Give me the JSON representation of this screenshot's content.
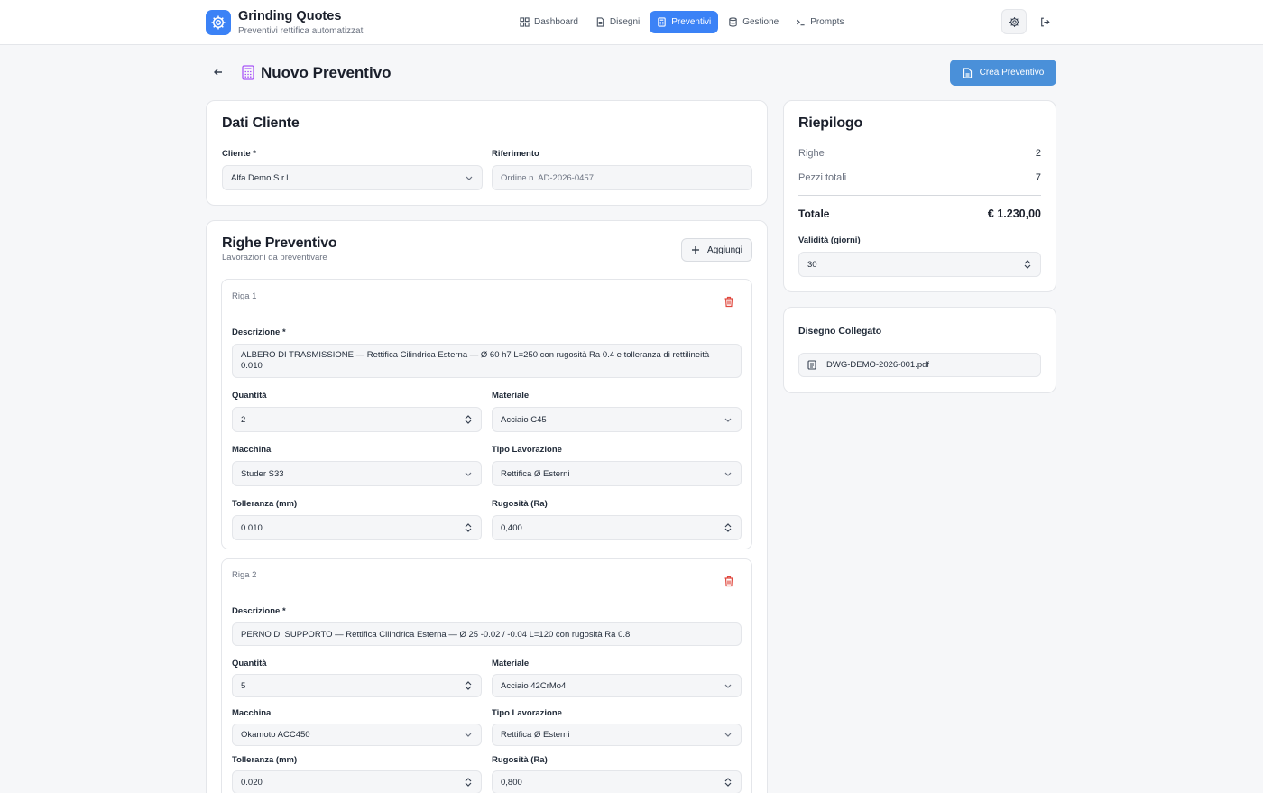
{
  "app": {
    "title": "Grinding Quotes",
    "subtitle": "Preventivi rettifica automatizzati"
  },
  "nav": [
    {
      "label": "Dashboard",
      "icon": "grid-icon",
      "active": false
    },
    {
      "label": "Disegni",
      "icon": "file-icon",
      "active": false
    },
    {
      "label": "Preventivi",
      "icon": "calculator-icon",
      "active": true
    },
    {
      "label": "Gestione",
      "icon": "database-icon",
      "active": false
    },
    {
      "label": "Prompts",
      "icon": "terminal-icon",
      "active": false
    }
  ],
  "colors": {
    "accent": "#3b82f6",
    "primary_button": "#4a90d9",
    "danger": "#e0483e",
    "page_icon": "#a855f7"
  },
  "page": {
    "title": "Nuovo Preventivo",
    "create_label": "Crea Preventivo"
  },
  "cliente": {
    "title": "Dati Cliente",
    "cliente_label": "Cliente *",
    "cliente_value": "Alfa Demo S.r.l.",
    "riferimento_label": "Riferimento",
    "riferimento_placeholder": "Ordine n. AD-2026-0457"
  },
  "righe": {
    "title": "Righe Preventivo",
    "subtitle": "Lavorazioni da preventivare",
    "add_label": "Aggiungi",
    "labels": {
      "descrizione": "Descrizione *",
      "quantita": "Quantità",
      "materiale": "Materiale",
      "macchina": "Macchina",
      "tipo": "Tipo Lavorazione",
      "tolleranza": "Tolleranza (mm)",
      "rugosita": "Rugosità (Ra)"
    },
    "items": [
      {
        "title": "Riga 1",
        "descrizione": "ALBERO DI TRASMISSIONE — Rettifica Cilindrica Esterna — Ø 60 h7 L=250 con rugosità Ra 0.4 e tolleranza di rettilineità 0.010",
        "quantita": "2",
        "materiale": "Acciaio C45",
        "macchina": "Studer S33",
        "tipo": "Rettifica Ø Esterni",
        "tolleranza": "0.010",
        "rugosita": "0,400"
      },
      {
        "title": "Riga 2",
        "descrizione": "PERNO DI SUPPORTO — Rettifica Cilindrica Esterna — Ø 25 -0.02 / -0.04 L=120 con rugosità Ra 0.8",
        "quantita": "5",
        "materiale": "Acciaio 42CrMo4",
        "macchina": "Okamoto ACC450",
        "tipo": "Rettifica Ø Esterni",
        "tolleranza": "0.020",
        "rugosita": "0,800"
      }
    ]
  },
  "riepilogo": {
    "title": "Riepilogo",
    "righe_label": "Righe",
    "righe_value": "2",
    "pezzi_label": "Pezzi totali",
    "pezzi_value": "7",
    "totale_label": "Totale",
    "totale_value": "€ 1.230,00",
    "validita_label": "Validità (giorni)",
    "validita_value": "30"
  },
  "disegno": {
    "title": "Disegno Collegato",
    "file": "DWG-DEMO-2026-001.pdf"
  }
}
